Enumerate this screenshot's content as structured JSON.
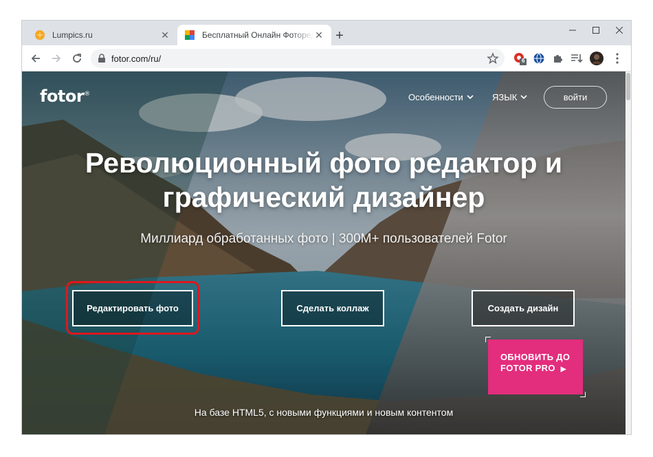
{
  "browser": {
    "tabs": [
      {
        "title": "Lumpics.ru",
        "active": false
      },
      {
        "title": "Бесплатный Онлайн Фоторедактор",
        "active": true
      }
    ],
    "url": "fotor.com/ru/",
    "extension_badge": "6"
  },
  "site": {
    "logo": "fotor",
    "logo_mark": "®",
    "nav": {
      "features": "Особенности",
      "language": "ЯЗЫК",
      "login": "войти"
    },
    "hero": {
      "title_line1": "Революционный фото редактор и",
      "title_line2": "графический дизайнер",
      "subtitle": "Миллиард обработанных фото | 300M+ пользователей Fotor"
    },
    "actions": {
      "edit_photo": "Редактировать фото",
      "make_collage": "Сделать коллаж",
      "create_design": "Создать дизайн"
    },
    "pro_badge": {
      "line1": "ОБНОВИТЬ ДО",
      "line2": "FOTOR PRO"
    },
    "footer_note": "На базе HTML5, с новыми функциями и новым контентом"
  },
  "colors": {
    "highlight": "#e0171d",
    "pro_badge": "#e32d7d"
  }
}
